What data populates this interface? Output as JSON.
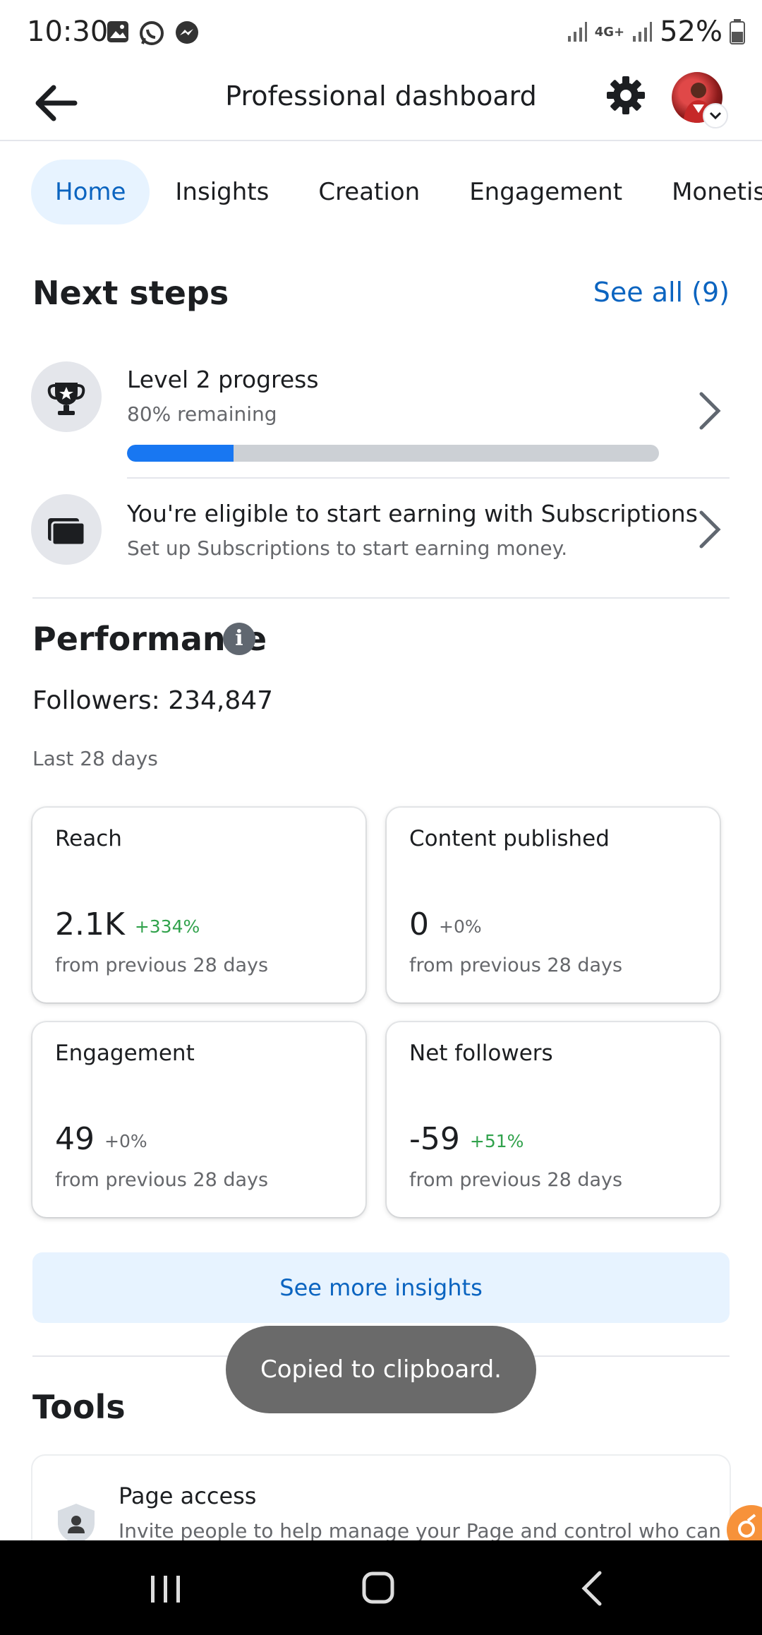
{
  "status": {
    "time": "10:30",
    "battery": "52%",
    "network": "4G+"
  },
  "header": {
    "title": "Professional dashboard"
  },
  "tabs": [
    {
      "label": "Home",
      "active": true
    },
    {
      "label": "Insights",
      "active": false
    },
    {
      "label": "Creation",
      "active": false
    },
    {
      "label": "Engagement",
      "active": false
    },
    {
      "label": "Monetisation",
      "active": false
    }
  ],
  "next_steps": {
    "title": "Next steps",
    "see_all": "See all (9)",
    "items": [
      {
        "title": "Level 2 progress",
        "subtitle": "80% remaining",
        "progress_fraction": 0.2,
        "icon": "trophy-icon"
      },
      {
        "title": "You're eligible to start earning with Subscriptions",
        "subtitle": "Set up Subscriptions to start earning money.",
        "icon": "subscriptions-icon"
      }
    ]
  },
  "performance": {
    "title": "Performance",
    "followers": "Followers: 234,847",
    "period": "Last 28 days",
    "cards": [
      {
        "title": "Reach",
        "value": "2.1K",
        "delta": "+334%",
        "delta_color": "#31a24c",
        "note": "from previous 28 days"
      },
      {
        "title": "Content published",
        "value": "0",
        "delta": "+0%",
        "delta_color": "#65676b",
        "note": "from previous 28 days"
      },
      {
        "title": "Engagement",
        "value": "49",
        "delta": "+0%",
        "delta_color": "#65676b",
        "note": "from previous 28 days"
      },
      {
        "title": "Net followers",
        "value": "-59",
        "delta": "+51%",
        "delta_color": "#31a24c",
        "note": "from previous 28 days"
      }
    ],
    "see_more": "See more insights"
  },
  "toast": "Copied to clipboard.",
  "tools": {
    "title": "Tools",
    "items": [
      {
        "title": "Page access",
        "subtitle": "Invite people to help manage your Page and control who can"
      }
    ]
  },
  "colors": {
    "accent": "#0b64c0",
    "progress": "#1877f2",
    "tab_active_bg": "#e7f3ff",
    "toast_bg": "#6a6a6a"
  }
}
